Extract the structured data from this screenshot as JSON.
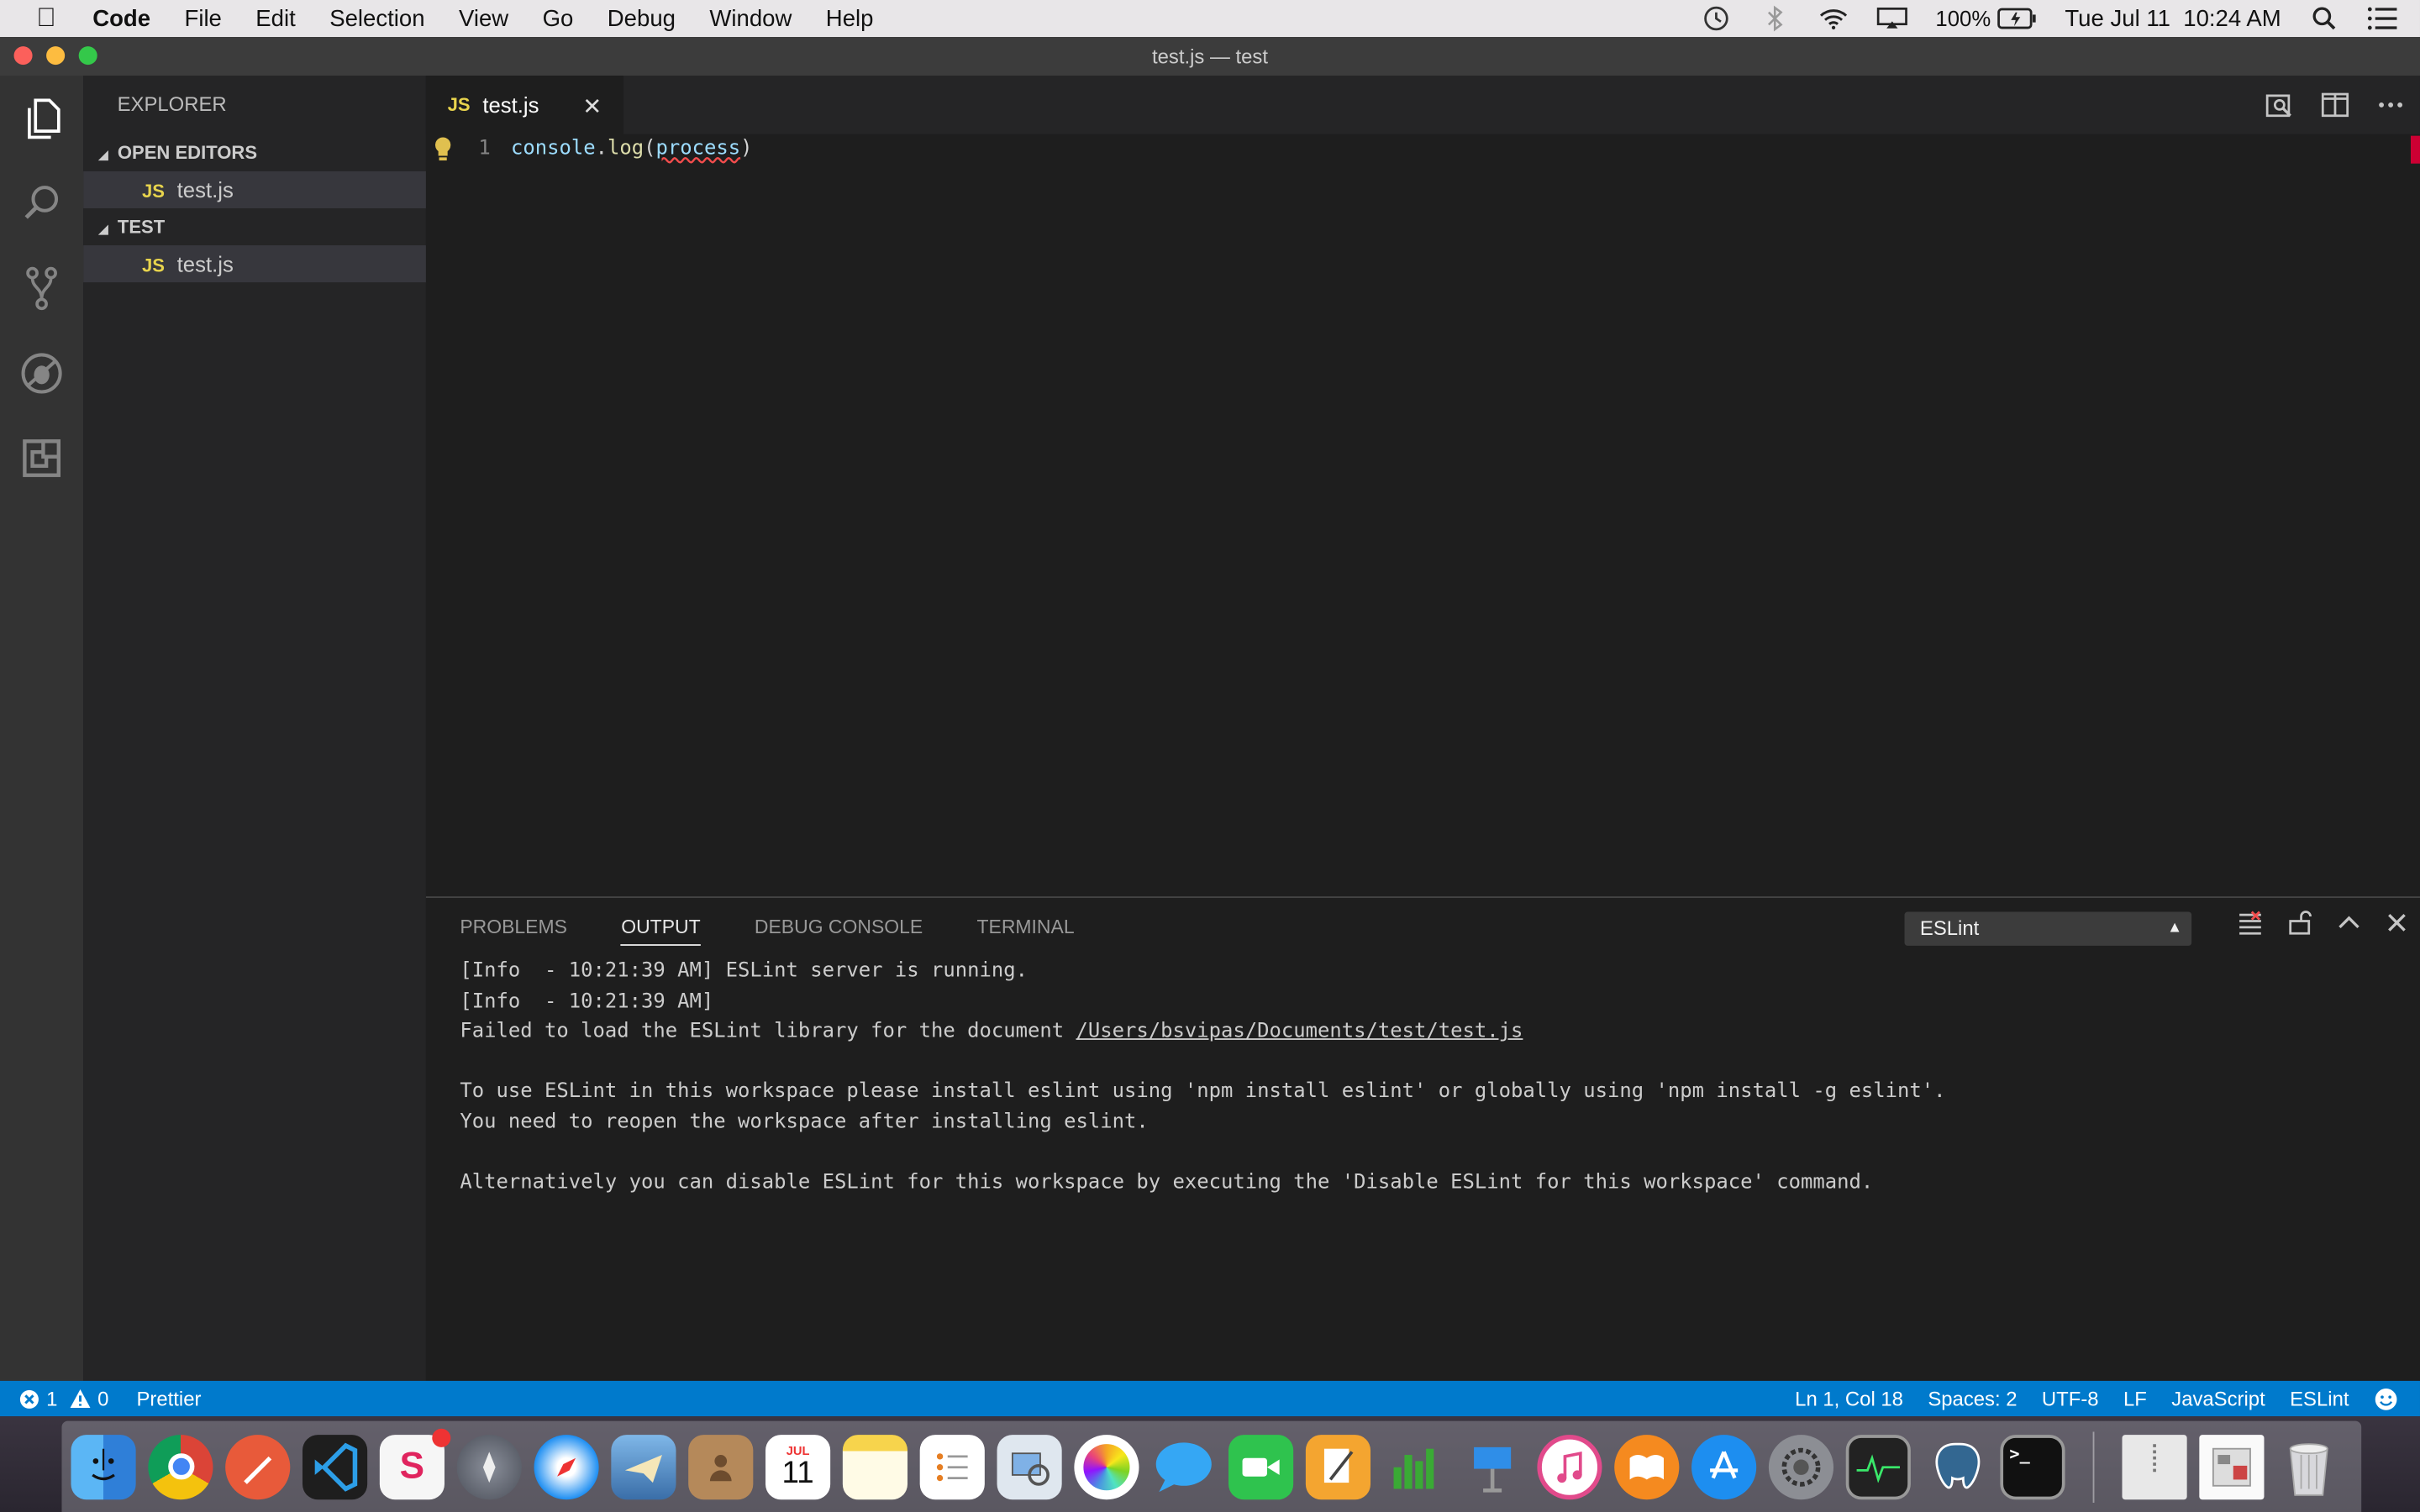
{
  "menubar": {
    "app_name": "Code",
    "items": [
      "File",
      "Edit",
      "Selection",
      "View",
      "Go",
      "Debug",
      "Window",
      "Help"
    ],
    "battery": "100%",
    "clock": "Tue Jul 11  10:24 AM"
  },
  "window": {
    "title": "test.js — test"
  },
  "sidebar": {
    "title": "EXPLORER",
    "open_editors": "OPEN EDITORS",
    "open_file": "test.js",
    "folder": "TEST",
    "folder_file": "test.js",
    "js_badge": "JS"
  },
  "editor": {
    "tab_label": "test.js",
    "tab_badge": "JS",
    "line_number": "1",
    "code": {
      "obj": "console",
      "dot": ".",
      "fn": "log",
      "open": "(",
      "arg": "process",
      "close": ")"
    }
  },
  "panel": {
    "tabs": [
      "PROBLEMS",
      "OUTPUT",
      "DEBUG CONSOLE",
      "TERMINAL"
    ],
    "active_tab": "OUTPUT",
    "channel": "ESLint",
    "output": {
      "line1": "[Info  - 10:21:39 AM] ESLint server is running.",
      "line2": "[Info  - 10:21:39 AM] ",
      "line3_prefix": "Failed to load the ESLint library for the document ",
      "line3_link": "/Users/bsvipas/Documents/test/test.js",
      "line4": "To use ESLint in this workspace please install eslint using 'npm install eslint' or globally using 'npm install -g eslint'.",
      "line5": "You need to reopen the workspace after installing eslint.",
      "line6": "Alternatively you can disable ESLint for this workspace by executing the 'Disable ESLint for this workspace' command."
    }
  },
  "status": {
    "errors": "1",
    "warnings": "0",
    "prettier": "Prettier",
    "position": "Ln 1, Col 18",
    "spaces": "Spaces: 2",
    "encoding": "UTF-8",
    "eol": "LF",
    "language": "JavaScript",
    "linter": "ESLint"
  },
  "dock": {
    "calendar_month": "JUL",
    "calendar_day": "11"
  },
  "colors": {
    "accent": "#007acc",
    "error": "#f14c4c",
    "js_yellow": "#e8d44d"
  }
}
